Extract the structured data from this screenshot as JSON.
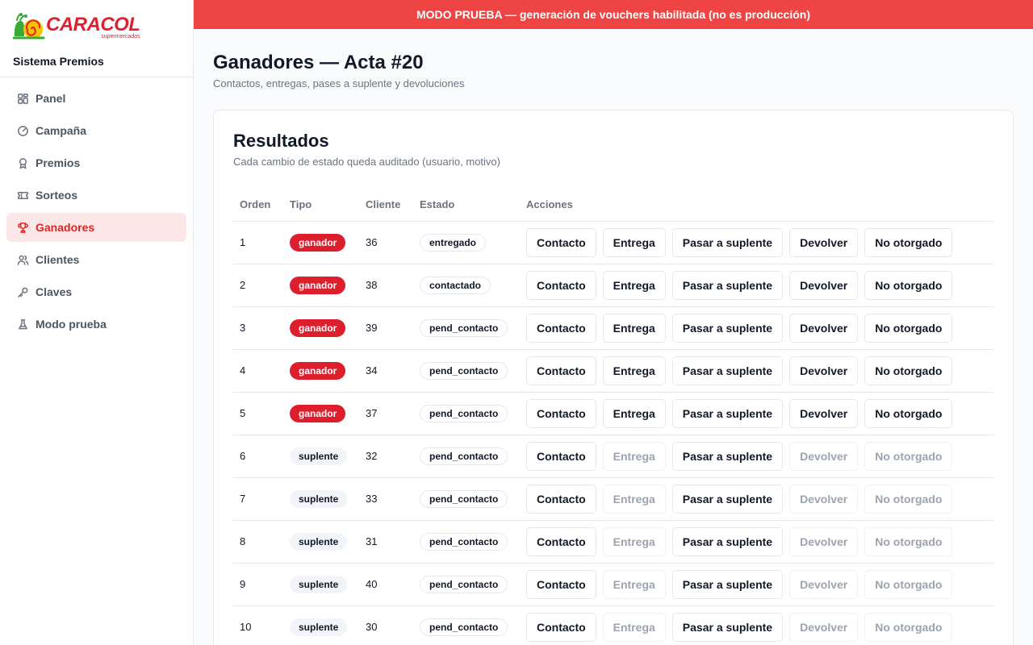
{
  "brand": {
    "logo_word": "CARACOL",
    "logo_sub": "supermercados",
    "app_name": "Sistema Premios",
    "colors": {
      "accent": "#dc2626",
      "logo_yellow": "#f5c400",
      "logo_green": "#3aa935"
    }
  },
  "nav": [
    {
      "label": "Panel",
      "icon": "grid-icon",
      "active": false
    },
    {
      "label": "Campaña",
      "icon": "gauge-icon",
      "active": false
    },
    {
      "label": "Premios",
      "icon": "award-icon",
      "active": false
    },
    {
      "label": "Sorteos",
      "icon": "ticket-icon",
      "active": false
    },
    {
      "label": "Ganadores",
      "icon": "trophy-icon",
      "active": true
    },
    {
      "label": "Clientes",
      "icon": "users-icon",
      "active": false
    },
    {
      "label": "Claves",
      "icon": "key-icon",
      "active": false
    },
    {
      "label": "Modo prueba",
      "icon": "flask-icon",
      "active": false
    }
  ],
  "banner": {
    "text": "MODO PRUEBA — generación de vouchers habilitada (no es producción)",
    "color": "#ef4444"
  },
  "page": {
    "title": "Ganadores — Acta #20",
    "subtitle": "Contactos, entregas, pases a suplente y devoluciones"
  },
  "card": {
    "title": "Resultados",
    "subtitle": "Cada cambio de estado queda auditado (usuario, motivo)"
  },
  "table": {
    "headers": {
      "orden": "Orden",
      "tipo": "Tipo",
      "cliente": "Cliente",
      "estado": "Estado",
      "acciones": "Acciones"
    },
    "action_labels": {
      "contacto": "Contacto",
      "entrega": "Entrega",
      "suplente": "Pasar a suplente",
      "devolver": "Devolver",
      "no_otorgado": "No otorgado"
    },
    "rows": [
      {
        "orden": "1",
        "tipo": "ganador",
        "cliente": "36",
        "estado": "entregado"
      },
      {
        "orden": "2",
        "tipo": "ganador",
        "cliente": "38",
        "estado": "contactado"
      },
      {
        "orden": "3",
        "tipo": "ganador",
        "cliente": "39",
        "estado": "pend_contacto"
      },
      {
        "orden": "4",
        "tipo": "ganador",
        "cliente": "34",
        "estado": "pend_contacto"
      },
      {
        "orden": "5",
        "tipo": "ganador",
        "cliente": "37",
        "estado": "pend_contacto"
      },
      {
        "orden": "6",
        "tipo": "suplente",
        "cliente": "32",
        "estado": "pend_contacto"
      },
      {
        "orden": "7",
        "tipo": "suplente",
        "cliente": "33",
        "estado": "pend_contacto"
      },
      {
        "orden": "8",
        "tipo": "suplente",
        "cliente": "31",
        "estado": "pend_contacto"
      },
      {
        "orden": "9",
        "tipo": "suplente",
        "cliente": "40",
        "estado": "pend_contacto"
      },
      {
        "orden": "10",
        "tipo": "suplente",
        "cliente": "30",
        "estado": "pend_contacto"
      }
    ]
  }
}
